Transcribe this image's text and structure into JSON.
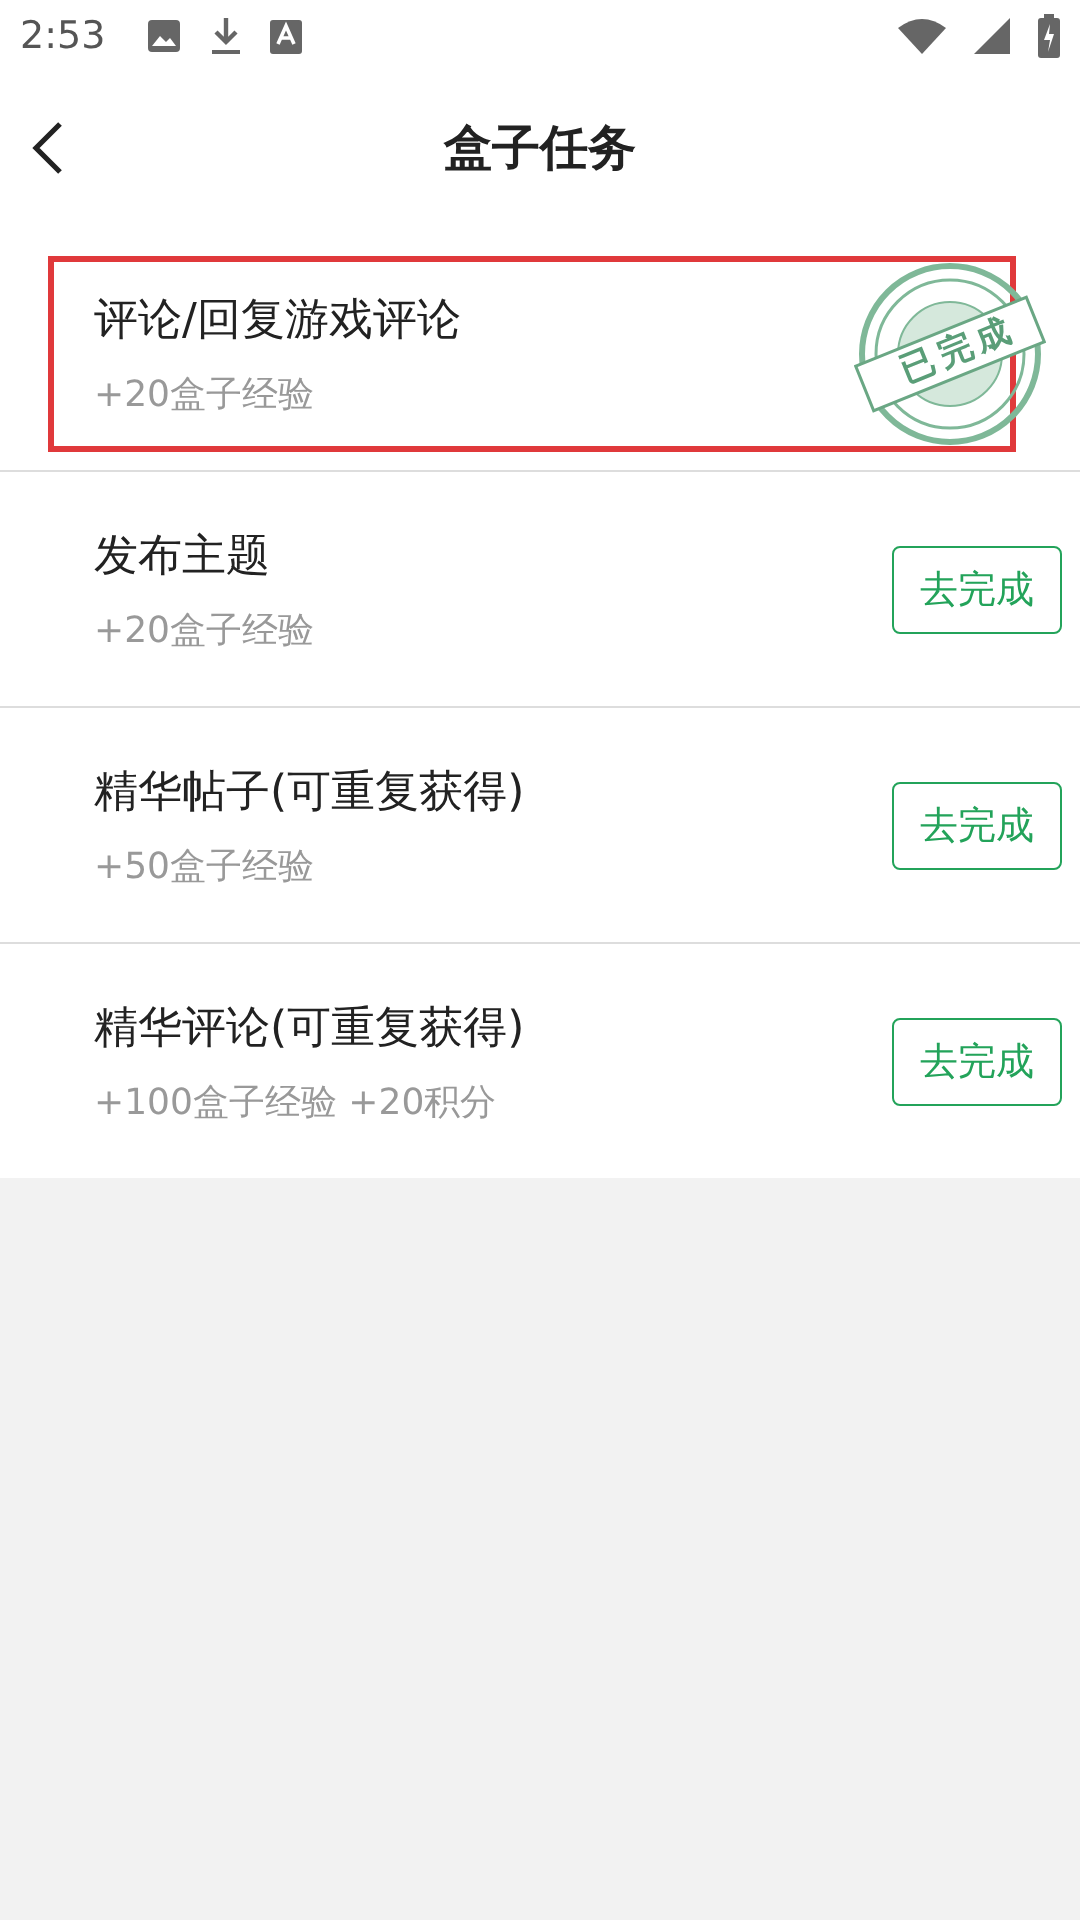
{
  "status_bar": {
    "time": "2:53"
  },
  "header": {
    "title": "盒子任务"
  },
  "tasks": [
    {
      "title": "评论/回复游戏评论",
      "reward": "+20盒子经验",
      "highlighted": true,
      "action": {
        "kind": "stamp",
        "label": "已完成"
      }
    },
    {
      "title": "发布主题",
      "reward": "+20盒子经验",
      "highlighted": false,
      "action": {
        "kind": "button",
        "label": "去完成"
      }
    },
    {
      "title": "精华帖子(可重复获得)",
      "reward": "+50盒子经验",
      "highlighted": false,
      "action": {
        "kind": "button",
        "label": "去完成"
      }
    },
    {
      "title": "精华评论(可重复获得)",
      "reward": "+100盒子经验 +20积分",
      "highlighted": false,
      "action": {
        "kind": "button",
        "label": "去完成"
      }
    }
  ]
}
